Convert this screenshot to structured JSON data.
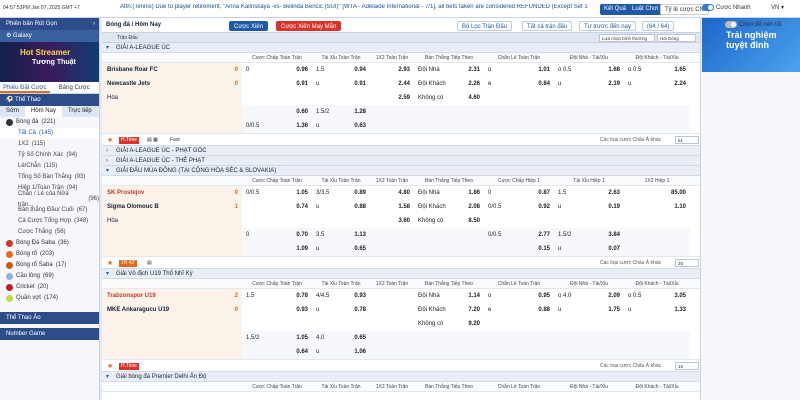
{
  "topbar": {
    "time": "04:57:53PM Jan 07, 2025 GMT +7",
    "ticker": "Attn:(Tennis) Due to player retirement, \"Anna Kalinskaya -vs- Belinda Bencic (SUI)\" [WTA - Adelaide International - 7/1], all bets taken are considered REFUNDED (Except Set 1",
    "btn_quick": "Kết Quả",
    "btn_rules": "Luật Chơi",
    "lang": "VN ▾"
  },
  "toggles": {
    "odds": "Tỷ lệ cược CN",
    "quick": "Cược Nhanh",
    "accept": "Chọn để nên tối"
  },
  "sidebar": {
    "deposit": "Phiên bản Rút Gọn",
    "galaxy": "Galaxy",
    "banner1": "Hot Streamer",
    "banner2": "Tương Thuật",
    "tab1": "Phiếu Đặt Cược",
    "tab2": "Bảng Cược",
    "sports_title": "Thể Thao",
    "sub1": "Sớm",
    "sub2": "Hôm Nay",
    "sub3": "Trực tiếp",
    "items": [
      {
        "label": "Bóng đá",
        "count": "(221)"
      },
      {
        "label": "Tất Cả",
        "count": "(145)"
      },
      {
        "label": "1X2",
        "count": "(115)"
      },
      {
        "label": "Tỷ Số Chính Xác",
        "count": "(94)"
      },
      {
        "label": "Lẻ/Chẵn",
        "count": "(115)"
      },
      {
        "label": "Tổng Số Bàn Thắng",
        "count": "(93)"
      },
      {
        "label": "Hiệp 1/Toàn Trận",
        "count": "(94)"
      },
      {
        "label": "Chẵn / Lẻ của Nửa trận...",
        "count": "(96)"
      },
      {
        "label": "Bàn thắng Đầu/ Cuối",
        "count": "(67)"
      },
      {
        "label": "Cả Cược Tổng Hợp",
        "count": "(348)"
      },
      {
        "label": "Cược Thắng",
        "count": "(56)"
      },
      {
        "label": "Bóng Đá Saba",
        "count": "(36)"
      },
      {
        "label": "Bóng rổ",
        "count": "(203)"
      },
      {
        "label": "Bóng rổ Saba",
        "count": "(17)"
      },
      {
        "label": "Cầu lông",
        "count": "(69)"
      },
      {
        "label": "Cricket",
        "count": "(20)"
      },
      {
        "label": "Quần vợt",
        "count": "(174)"
      }
    ],
    "virtual": "Thể Thao Ảo",
    "number": "Number Game"
  },
  "right": {
    "banner": "Trải nghiệm tuyệt đỉnh"
  },
  "toolbar": {
    "title": "Bóng đá / Hôm Nay",
    "chip1": "Cược Xiên",
    "chip2": "Cược Xiên May Mắn",
    "filter": "Bộ Lọc Trận Đấu",
    "types": "Tất cả trận đấu",
    "bytime": "Tư trước đến nay",
    "count": "(64 / 64)"
  },
  "subbar": {
    "label": "Trận Đấu",
    "sort": "Lựa chọn bình thường",
    "tz": "Hai Dòng"
  },
  "headers1": [
    "Cược Chấp Toàn Trận",
    "Tài Xỉu Toàn Trận",
    "1X2 Toàn Trận",
    "Bàn Thắng Tiếp Theo",
    "Chẵn Lẻ Toàn Trận",
    "Đội Nhà - Tài/Xỉu",
    "Đội Khách - Tài/Xỉu"
  ],
  "headers2": [
    "Cược Chấp Toàn Trận",
    "Tài Xỉu Toàn Trận",
    "1X2 Toàn Trận",
    "Bàn Thắng Tiếp Theo",
    "Cược Chấp Hiệp 1",
    "Tài Xỉu Hiệp 1",
    "1X2 Hiệp 1"
  ],
  "headers3": [
    "Cược Chấp Toàn Trận",
    "Tài Xỉu Toàn Trận",
    "1X2 Toàn Trận",
    "Bàn Thắng Tiếp Theo",
    "Chẵn Lẻ Toàn Trận",
    "Đội Nhà - Tài/Xỉu",
    "Đội Khách - Tài/Xỉu"
  ],
  "leagues": {
    "l1": "GIẢI A-LEAGUE ÚC",
    "l2": "GIẢI A-LEAGUE ÚC - PHẠT GÓC",
    "l3": "GIẢI A-LEAGUE ÚC - THẺ PHẠT",
    "l4": "GIẢI ĐẤU MÙA ĐÔNG (TẠI CỘNG HÒA SÉC & SLOVAKIA)",
    "l5": "Giải Vô địch U19 Thổ Nhĩ Kỳ",
    "l6": "Giải bóng đá Premier Delhi Ấn Độ"
  },
  "m1": {
    "home": "Brisbane Roar FC",
    "away": "Newcastle Jets",
    "draw": "Hòa",
    "sh": "0",
    "sa": "0"
  },
  "m2": {
    "home": "SK Prostejov",
    "away": "Sigma Olomouc B",
    "draw": "Hòa",
    "sh": "0",
    "sa": "1"
  },
  "m3": {
    "home": "Trabzonspor U19",
    "away": "MKE Ankaragucu U19",
    "sh": "2",
    "sa": "0"
  },
  "f1": {
    "tag": "H.Time",
    "fast": "Fast",
    "oth": "Các loại cược Châu Á khác",
    "sel": "51"
  },
  "f2": {
    "tag": "1H 42'",
    "oth": "Các loại cược Châu Á khác",
    "sel": "25"
  },
  "f3": {
    "tag": "H.Time",
    "oth": "Các loại cược Châu Á khác",
    "sel": "15"
  },
  "r1": [
    [
      "0",
      "0.96",
      "1.5",
      "0.94",
      "2.93",
      "Đội Nhà",
      "2.31",
      "o",
      "1.01",
      "o 0.5",
      "1.68",
      "o 0.5",
      "1.65"
    ],
    [
      "",
      "0.91",
      "u",
      "0.91",
      "2.44",
      "Đội Khách",
      "2.26",
      "e",
      "0.84",
      "u",
      "2.19",
      "u",
      "2.24"
    ],
    [
      "",
      "",
      "",
      "",
      "2.59",
      "Không có",
      "4.60",
      "",
      "",
      "",
      "",
      "",
      ""
    ],
    [
      "",
      "0.60",
      "1.5/2",
      "1.28",
      "",
      "",
      "",
      "",
      "",
      "",
      "",
      "",
      ""
    ],
    [
      "0/0.5",
      "1.36",
      "u",
      "0.63",
      "",
      "",
      "",
      "",
      "",
      "",
      "",
      "",
      ""
    ]
  ],
  "r2": [
    [
      "0/0.5",
      "1.05",
      "3/3.5",
      "0.89",
      "4.80",
      "Đội Nhà",
      "1.86",
      "0",
      "0.87",
      "1.5",
      "2.63",
      "",
      "85.00"
    ],
    [
      "",
      "0.74",
      "u",
      "0.88",
      "1.58",
      "Đội Khách",
      "2.08",
      "0/0.5",
      "0.92",
      "u",
      "0.19",
      "",
      "1.10"
    ],
    [
      "",
      "",
      "",
      "",
      "3.60",
      "Không có",
      "8.50",
      "",
      "",
      "",
      "",
      "",
      ""
    ],
    [
      "0",
      "0.70",
      "3.5",
      "1.13",
      "",
      "",
      "",
      "0/0.5",
      "2.77",
      "1.5/2",
      "3.84",
      "",
      ""
    ],
    [
      "",
      "1.09",
      "u",
      "0.65",
      "",
      "",
      "",
      "",
      "0.15",
      "u",
      "0.07",
      "",
      ""
    ]
  ],
  "r3": [
    [
      "1.5",
      "0.78",
      "4/4.5",
      "0.93",
      "",
      "Đội Nhà",
      "1.14",
      "o",
      "0.95",
      "o 4.0",
      "2.09",
      "o 0.5",
      "3.05"
    ],
    [
      "",
      "0.93",
      "u",
      "0.78",
      "",
      "Đội Khách",
      "7.20",
      "e",
      "0.88",
      "u",
      "1.75",
      "u",
      "1.33"
    ],
    [
      "",
      "",
      "",
      "",
      "",
      "Không có",
      "9.20",
      "",
      "",
      "",
      "",
      "",
      ""
    ],
    [
      "1.5/2",
      "1.05",
      "4.0",
      "0.65",
      "",
      "",
      "",
      "",
      "",
      "",
      "",
      "",
      ""
    ],
    [
      "",
      "0.64",
      "u",
      "1.06",
      "",
      "",
      "",
      "",
      "",
      "",
      "",
      "",
      ""
    ]
  ]
}
